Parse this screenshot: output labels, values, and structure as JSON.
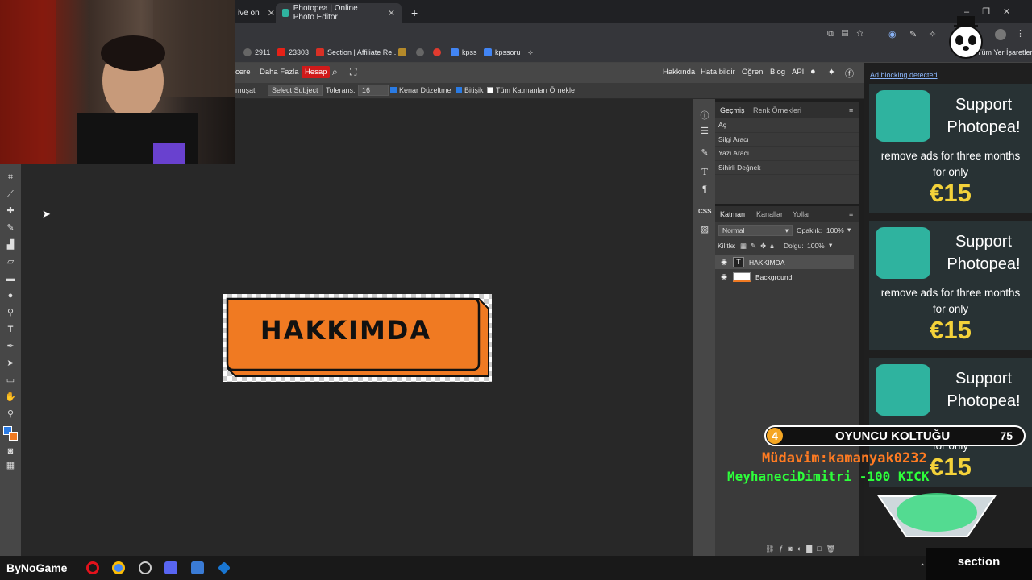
{
  "browser": {
    "tabs": [
      {
        "label": "ive on",
        "active": false
      },
      {
        "label": "Photopea | Online Photo Editor",
        "active": true
      }
    ],
    "new_tab": "+",
    "bookmarks": [
      {
        "label": "2911",
        "icon": "dark-icon"
      },
      {
        "label": "23303",
        "icon": "youtube-icon"
      },
      {
        "label": "Section | Affiliate Re...",
        "icon": "section-icon"
      },
      {
        "label": "kpss",
        "icon": "doc-icon"
      },
      {
        "label": "kpssoru",
        "icon": "doc-icon"
      }
    ],
    "bookmarks_right": "Tüm Yer İşaretleri"
  },
  "menubar": {
    "left_partial": "cere",
    "more": "Daha Fazla",
    "account": "Hesap",
    "right_items": [
      "Hakkında",
      "Hata bildir",
      "Öğren",
      "Blog",
      "API"
    ]
  },
  "tool_options": {
    "partial": "muşat",
    "select_subject": "Select Subject",
    "tolerance_label": "Tolerans:",
    "tolerance_value": "16",
    "anti_alias": "Kenar Düzeltme",
    "contiguous": "Bitişik",
    "sample_all": "Tüm Katmanları Örnekle"
  },
  "document": {
    "text": "HAKKIMDA",
    "accent": "#f07a22"
  },
  "history_panel": {
    "tabs": [
      "Geçmiş",
      "Renk Örnekleri"
    ],
    "items": [
      "Aç",
      "Silgi Aracı",
      "Yazı Aracı",
      "Sihirli Değnek"
    ]
  },
  "layers_panel": {
    "tabs": [
      "Katman",
      "Kanallar",
      "Yollar"
    ],
    "blend_mode": "Normal",
    "opacity_label": "Opaklık:",
    "opacity_value": "100%",
    "lock_label": "Kilitle:",
    "fill_label": "Dolgu:",
    "fill_value": "100%",
    "layers": [
      {
        "name": "HAKKIMDA",
        "type": "text",
        "selected": true
      },
      {
        "name": "Background",
        "type": "image",
        "selected": false
      }
    ]
  },
  "ads": {
    "warning": "Ad blocking detected",
    "title": "Support Photopea!",
    "subtitle": "remove ads for three months for only",
    "price": "€15"
  },
  "overlays": {
    "seat_number": "4",
    "seat_label": "OYUNCU KOLTUĞU",
    "seat_count": "75",
    "regular": "Müdavim:kamanyak0232",
    "ticker": "MeyhaneciDimitri -100 KICK"
  },
  "taskbar": {
    "watermark": "ByNoGame",
    "section_logo": "section"
  }
}
